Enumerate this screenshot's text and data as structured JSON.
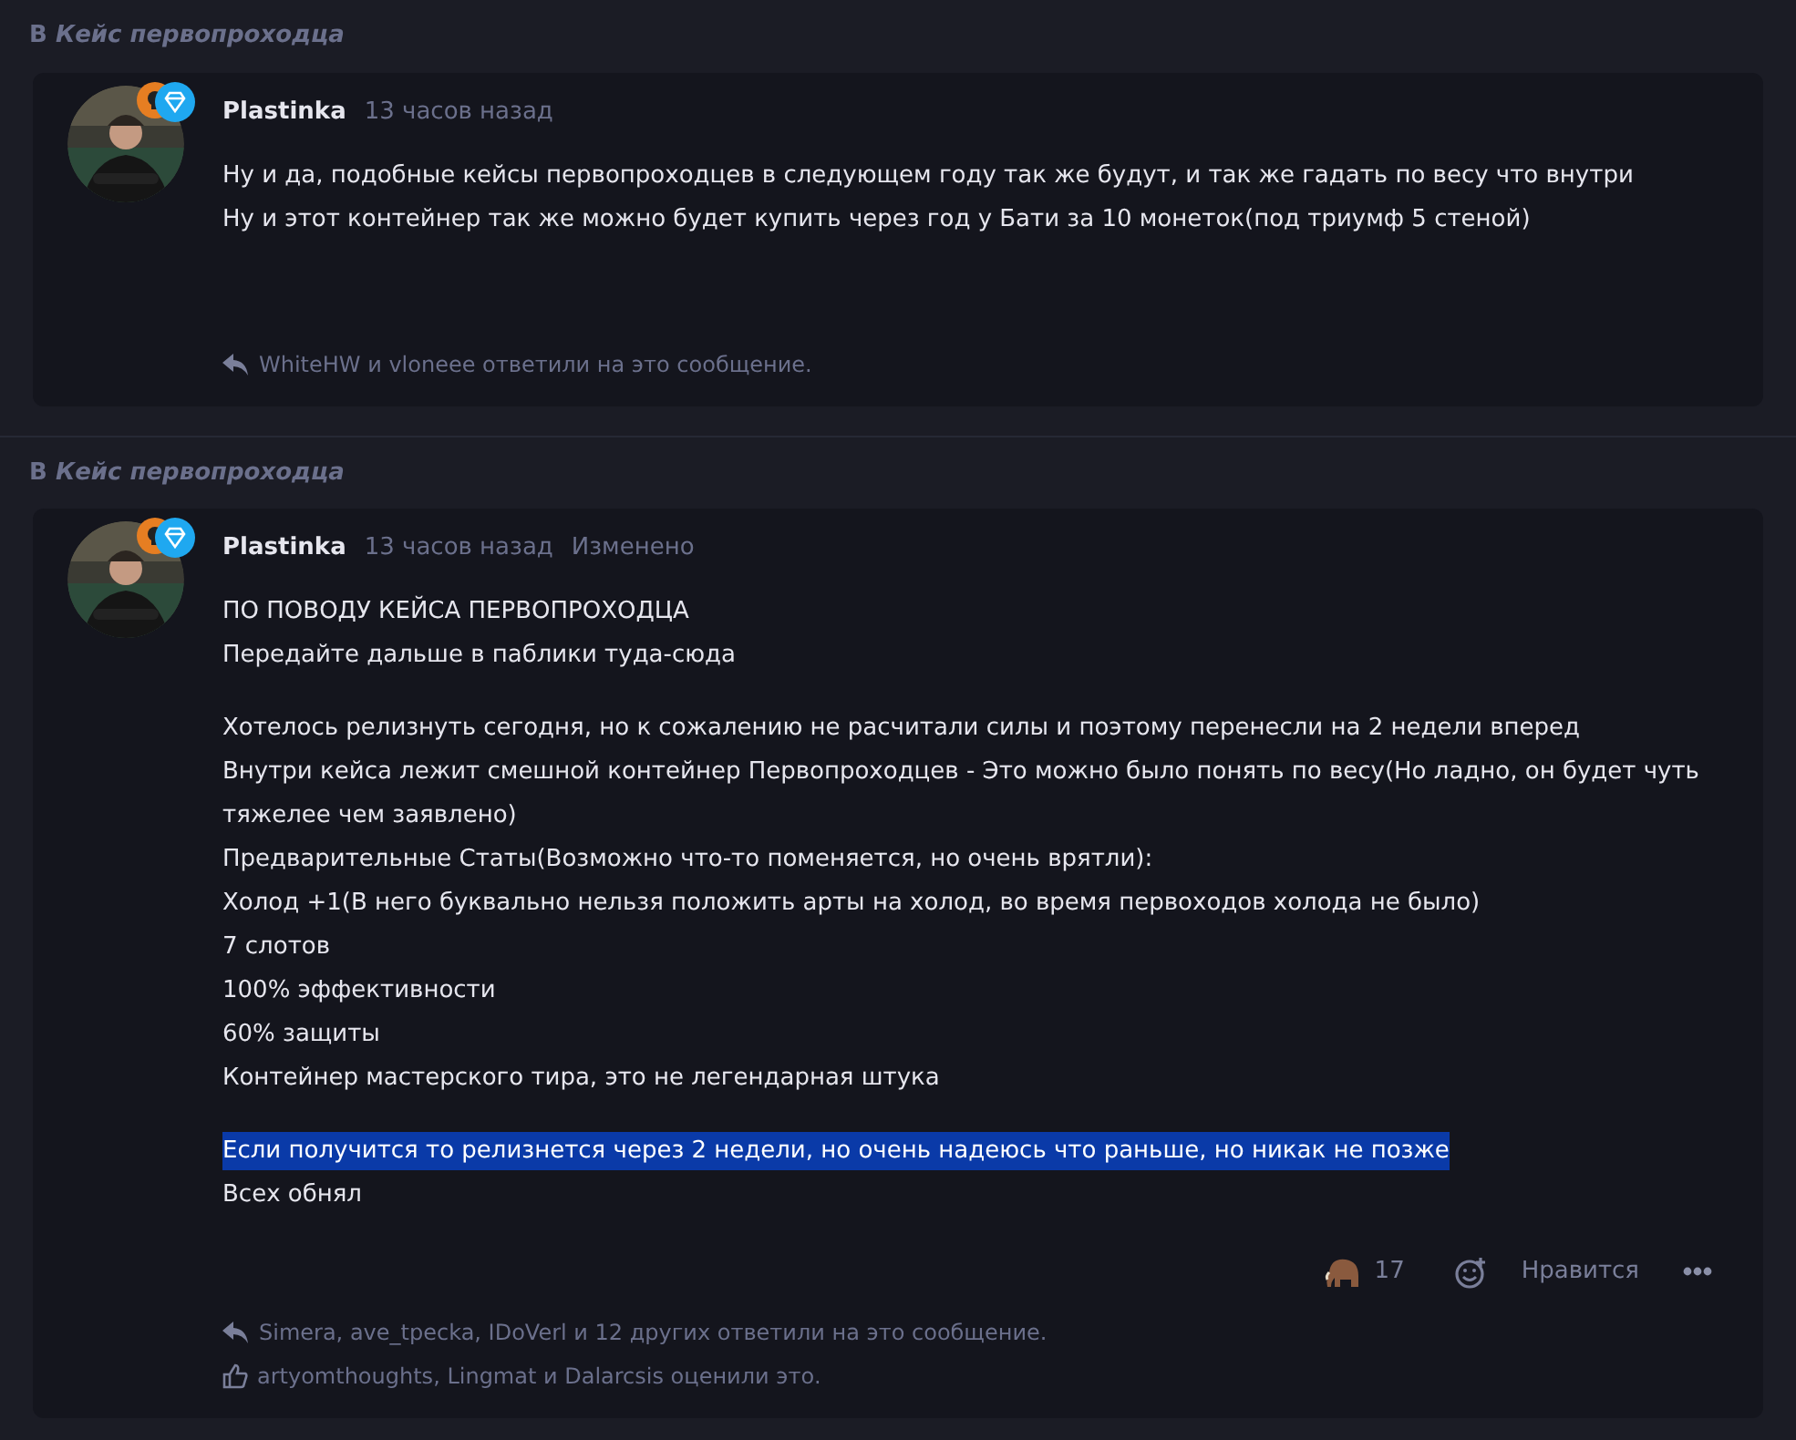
{
  "posts": [
    {
      "thread_prefix": "В",
      "thread": "Кейс первопроходца",
      "author": "Plastinka",
      "time": "13 часов назад",
      "paragraphs": [
        [
          {
            "text": "Ну и да, подобные кейсы первопроходцев в следующем году так же будут, и так же гадать по весу что внутри",
            "highlighted": false
          },
          {
            "text": "Ну и этот контейнер так же можно будет купить через год у Бати за 10 монеток(под триумф 5 стеной)",
            "highlighted": false
          }
        ]
      ],
      "replies": "WhiteHW и vloneee ответили на это сообщение."
    },
    {
      "thread_prefix": "В",
      "thread": "Кейс первопроходца",
      "author": "Plastinka",
      "time": "13 часов назад",
      "edited": "Изменено",
      "paragraphs": [
        [
          {
            "text": "ПО ПОВОДУ КЕЙСА ПЕРВОПРОХОДЦА",
            "highlighted": false
          },
          {
            "text": "Передайте дальше в паблики туда-сюда",
            "highlighted": false
          }
        ],
        [
          {
            "text": "Хотелось релизнуть сегодня, но к сожалению не расчитали силы и поэтому перенесли на 2 недели вперед",
            "highlighted": false
          },
          {
            "text": "Внутри кейса лежит смешной контейнер Первопроходцев - Это можно было понять по весу(Но ладно, он будет чуть тяжелее чем заявлено)",
            "highlighted": false
          },
          {
            "text": "Предварительные Статы(Возможно что-то поменяется, но очень врятли):",
            "highlighted": false
          },
          {
            "text": "Холод +1(В него буквально нельзя положить арты на холод, во время первоходов холода не было)",
            "highlighted": false
          },
          {
            "text": "7 слотов",
            "highlighted": false
          },
          {
            "text": "100% эффективности",
            "highlighted": false
          },
          {
            "text": "60% защиты",
            "highlighted": false
          },
          {
            "text": "Контейнер мастерского тира, это не легендарная штука",
            "highlighted": false
          }
        ],
        [
          {
            "text": "Если получится то релизнется через 2 недели, но очень надеюсь что раньше, но никак не позже",
            "highlighted": true
          },
          {
            "text": "Всех обнял",
            "highlighted": false
          }
        ]
      ],
      "reactions": {
        "count": "17",
        "like_label": "Нравится"
      },
      "replies": "Simera, ave_tpecka, IDoVerl и 12 других ответили на это сообщение.",
      "likes": "artyomthoughts, Lingmat и Dalarcsis оценили это."
    }
  ]
}
